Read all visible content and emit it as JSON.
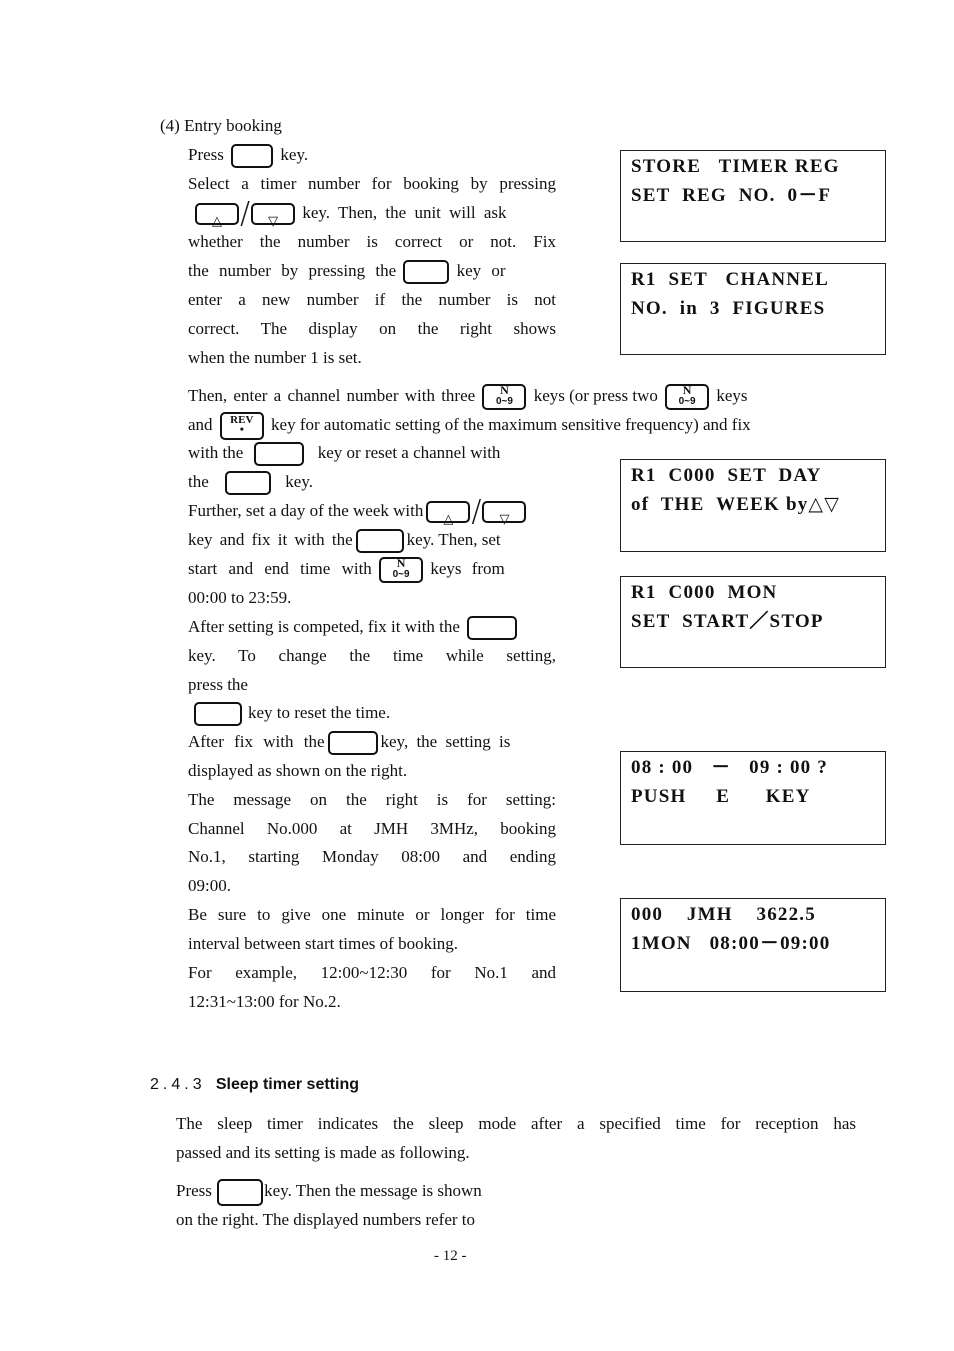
{
  "section": {
    "heading": "(4) Entry booking",
    "paragraph_lines": [
      {
        "pre": "Press",
        "post": "key."
      },
      {
        "text": "Select a timer number for booking by pressing"
      },
      {
        "post": "key.  Then, the unit will ask"
      },
      {
        "text": "whether the number is correct or not.  Fix"
      },
      {
        "pre": "the number by pressing the",
        "post": "key or"
      },
      {
        "text": "enter a new number if the number is not"
      },
      {
        "text": "correct.  The display on the right shows"
      },
      {
        "text": "when the number 1 is set."
      }
    ],
    "wide_lines": [
      {
        "a": "Then, enter a channel number with three",
        "b": "keys (or press two",
        "c": "keys"
      },
      {
        "a": "and",
        "b": "key for automatic setting of the maximum sensitive frequency) and fix"
      }
    ],
    "lines2": [
      {
        "pre": "with the",
        "post": "key or reset a channel with"
      },
      {
        "pre": "the",
        "post": "key."
      },
      {
        "pre": "Further, set a day of the week with"
      },
      {
        "pre": "key and fix it with the",
        "post": "key. Then, set"
      },
      {
        "pre": "start and end time with",
        "post": "keys from"
      },
      {
        "text": "00:00 to 23:59."
      },
      {
        "pre": "After setting is competed, fix it with the"
      },
      {
        "text": "key.   To change the time while setting,"
      },
      {
        "text": "press the"
      },
      {
        "post": "key to reset the time."
      },
      {
        "pre": "After fix with the",
        "post": "key, the setting is"
      },
      {
        "text": "displayed as shown on the right."
      },
      {
        "text": "The message on the right is for setting:"
      },
      {
        "text": "Channel No.000 at JMH 3MHz, booking"
      },
      {
        "text": "No.1, starting Monday 08:00 and ending"
      },
      {
        "text": "09:00."
      },
      {
        "text": "Be sure to give one minute or longer for time"
      },
      {
        "text": "interval between start times of booking."
      },
      {
        "text": "For example, 12:00~12:30 for No.1 and"
      },
      {
        "text": "12:31~13:00 for No.2."
      }
    ]
  },
  "keys": {
    "up": "△",
    "down": "▽",
    "num_top": "N",
    "num_bottom": "0~9",
    "rev_top": "REV",
    "rev_bottom": "•",
    "slash": "/"
  },
  "displays": [
    {
      "line1": "STORE   TIMER REG",
      "line2": "SET  REG  NO.  0－F"
    },
    {
      "line1": "R1  SET   CHANNEL",
      "line2": "NO.  in  3  FIGURES"
    },
    {
      "line1": "R1  C000  SET  DAY",
      "line2": "of  THE  WEEK by△▽"
    },
    {
      "line1": "R1  C000  MON",
      "line2": "SET  START／STOP"
    },
    {
      "line1": "08 : 00   －   09 : 00 ?",
      "line2": "PUSH     E      KEY"
    },
    {
      "line1": "000    JMH    3622.5",
      "line2": "1MON   08:00－09:00"
    }
  ],
  "subsection": {
    "number": "2.4.3",
    "title": "Sleep timer setting",
    "lines": [
      {
        "text": "The sleep timer indicates the sleep mode after a specified time for reception has"
      },
      {
        "text": "passed and its setting is made as following."
      },
      {
        "pre": "Press",
        "post": "key.   Then the message is shown"
      },
      {
        "text": "on the right.   The displayed numbers refer to"
      }
    ]
  },
  "footer": {
    "page_number": "- 12 -"
  }
}
